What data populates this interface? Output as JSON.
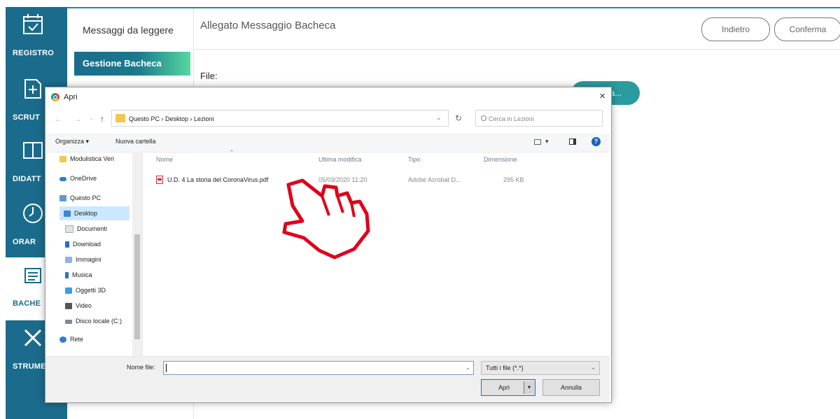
{
  "sidebar": {
    "items": [
      {
        "label": "REGISTRO",
        "icon": "calendar-check-icon"
      },
      {
        "label": "SCRUT",
        "icon": "add-document-icon"
      },
      {
        "label": "DIDATT",
        "icon": "book-icon"
      },
      {
        "label": "ORAR",
        "icon": "clock-icon"
      },
      {
        "label": "BACHE",
        "icon": "bulletin-board-icon",
        "active": true
      },
      {
        "label": "STRUME",
        "icon": "tools-icon"
      }
    ]
  },
  "submenu": {
    "items": [
      {
        "label": "Messaggi da leggere"
      },
      {
        "label": "Gestione Bacheca",
        "active": true
      }
    ]
  },
  "header": {
    "title": "Allegato Messaggio Bacheca",
    "back_label": "Indietro",
    "confirm_label": "Conferma"
  },
  "form": {
    "file_label": "File:",
    "upload_label": "Sfoglia..."
  },
  "dialog": {
    "title": "Apri",
    "close": "×",
    "address_path": "Questo PC  ›  Desktop  ›  Lezioni",
    "search_placeholder": "Cerca in Lezioni",
    "toolbar": {
      "organize": "Organizza ▾",
      "new_folder": "Nuova cartella"
    },
    "nav_items": [
      {
        "label": "Modulistica Veri",
        "icon": "folder-icon"
      },
      {
        "label": "OneDrive",
        "icon": "cloud-icon"
      },
      {
        "label": "Questo PC",
        "icon": "computer-icon"
      },
      {
        "label": "Desktop",
        "icon": "desktop-icon",
        "selected": true
      },
      {
        "label": "Documenti",
        "icon": "documents-icon"
      },
      {
        "label": "Download",
        "icon": "download-icon"
      },
      {
        "label": "Immagini",
        "icon": "images-icon"
      },
      {
        "label": "Musica",
        "icon": "music-icon"
      },
      {
        "label": "Oggetti 3D",
        "icon": "cube-icon"
      },
      {
        "label": "Video",
        "icon": "video-icon"
      },
      {
        "label": "Disco locale (C:)",
        "icon": "drive-icon"
      },
      {
        "label": "Rete",
        "icon": "network-icon"
      }
    ],
    "columns": {
      "name": "Nome",
      "modified": "Ultima modifica",
      "type": "Tipo",
      "size": "Dimensione"
    },
    "files": [
      {
        "name": "U.D. 4 La storia del CoronaVirus.pdf",
        "modified": "05/03/2020 11:20",
        "type": "Adobe Acrobat D...",
        "size": "295 KB"
      }
    ],
    "filename_label": "Nome file:",
    "filename_value": "",
    "filetype": "Tutti i file (*.*)",
    "open_label": "Apri",
    "cancel_label": "Annulla"
  },
  "colors": {
    "sidebar": "#1b6c8c",
    "accent": "#2a9ca0",
    "selection": "#cce8ff"
  }
}
